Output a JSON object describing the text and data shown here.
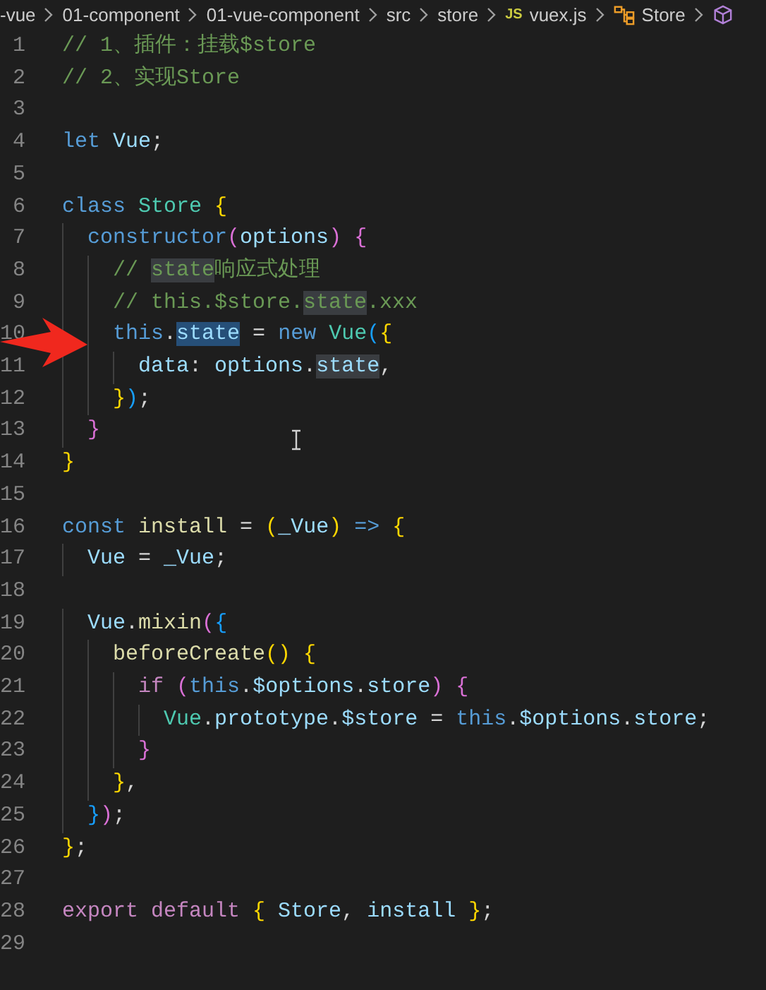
{
  "breadcrumb": [
    {
      "label": "-vue",
      "kind": "folder"
    },
    {
      "label": "01-component",
      "kind": "folder"
    },
    {
      "label": "01-vue-component",
      "kind": "folder"
    },
    {
      "label": "src",
      "kind": "folder"
    },
    {
      "label": "store",
      "kind": "folder"
    },
    {
      "label": "vuex.js",
      "kind": "js",
      "badge": "JS"
    },
    {
      "label": "Store",
      "kind": "class"
    },
    {
      "kind": "cube"
    }
  ],
  "editor": {
    "lines": [
      {
        "n": "1",
        "tokens": [
          {
            "t": "// 1、插件：挂载$store",
            "kind": "comment"
          }
        ]
      },
      {
        "n": "2",
        "tokens": [
          {
            "t": "// 2、实现Store",
            "kind": "comment"
          }
        ]
      },
      {
        "n": "3"
      },
      {
        "n": "4",
        "tokens": [
          {
            "t": "let ",
            "kind": "keyword"
          },
          {
            "t": "Vue",
            "kind": "variable"
          },
          {
            "t": ";",
            "kind": "plain"
          }
        ]
      },
      {
        "n": "5"
      },
      {
        "n": "6",
        "tokens": [
          {
            "t": "class ",
            "kind": "keyword"
          },
          {
            "t": "Store ",
            "kind": "class"
          },
          {
            "t": "{",
            "kind": "bracket1"
          }
        ]
      },
      {
        "n": "7",
        "tokens": [
          {
            "t": "  constructor",
            "kind": "keyword"
          },
          {
            "t": "(",
            "kind": "bracket2"
          },
          {
            "t": "options",
            "kind": "variable"
          },
          {
            "t": ") ",
            "kind": "bracket2"
          },
          {
            "t": "{",
            "kind": "bracket2"
          }
        ]
      },
      {
        "n": "8",
        "tokens": [
          {
            "t": "    // ",
            "kind": "comment"
          },
          {
            "t": "state",
            "kind": "comment",
            "matched": true
          },
          {
            "t": "响应式处理",
            "kind": "comment"
          }
        ]
      },
      {
        "n": "9",
        "tokens": [
          {
            "t": "    // this.$store.",
            "kind": "comment"
          },
          {
            "t": "state",
            "kind": "comment",
            "matched": true
          },
          {
            "t": ".xxx",
            "kind": "comment"
          }
        ]
      },
      {
        "n": "10",
        "tokens": [
          {
            "t": "    this",
            "kind": "keyword"
          },
          {
            "t": ".",
            "kind": "plain"
          },
          {
            "t": "state",
            "kind": "variable",
            "selected": true
          },
          {
            "t": " = ",
            "kind": "plain"
          },
          {
            "t": "new ",
            "kind": "keyword"
          },
          {
            "t": "Vue",
            "kind": "class"
          },
          {
            "t": "(",
            "kind": "bracket3"
          },
          {
            "t": "{",
            "kind": "bracket1"
          }
        ]
      },
      {
        "n": "11",
        "tokens": [
          {
            "t": "      data",
            "kind": "variable"
          },
          {
            "t": ": ",
            "kind": "plain"
          },
          {
            "t": "options",
            "kind": "variable"
          },
          {
            "t": ".",
            "kind": "plain"
          },
          {
            "t": "state",
            "kind": "variable",
            "matched": true
          },
          {
            "t": ",",
            "kind": "plain"
          }
        ]
      },
      {
        "n": "12",
        "tokens": [
          {
            "t": "    }",
            "kind": "bracket1"
          },
          {
            "t": ")",
            "kind": "bracket3"
          },
          {
            "t": ";",
            "kind": "plain"
          }
        ]
      },
      {
        "n": "13",
        "tokens": [
          {
            "t": "  }",
            "kind": "bracket2"
          }
        ]
      },
      {
        "n": "14",
        "tokens": [
          {
            "t": "}",
            "kind": "bracket1"
          }
        ]
      },
      {
        "n": "15"
      },
      {
        "n": "16",
        "tokens": [
          {
            "t": "const ",
            "kind": "keyword"
          },
          {
            "t": "install",
            "kind": "function"
          },
          {
            "t": " = ",
            "kind": "plain"
          },
          {
            "t": "(",
            "kind": "bracket1"
          },
          {
            "t": "_Vue",
            "kind": "variable"
          },
          {
            "t": ")",
            "kind": "bracket1"
          },
          {
            "t": " => ",
            "kind": "keyword"
          },
          {
            "t": "{",
            "kind": "bracket1"
          }
        ]
      },
      {
        "n": "17",
        "tokens": [
          {
            "t": "  Vue",
            "kind": "variable"
          },
          {
            "t": " = ",
            "kind": "plain"
          },
          {
            "t": "_Vue",
            "kind": "variable"
          },
          {
            "t": ";",
            "kind": "plain"
          }
        ]
      },
      {
        "n": "18"
      },
      {
        "n": "19",
        "tokens": [
          {
            "t": "  Vue",
            "kind": "variable"
          },
          {
            "t": ".",
            "kind": "plain"
          },
          {
            "t": "mixin",
            "kind": "function"
          },
          {
            "t": "(",
            "kind": "bracket2"
          },
          {
            "t": "{",
            "kind": "bracket3"
          }
        ]
      },
      {
        "n": "20",
        "tokens": [
          {
            "t": "    beforeCreate",
            "kind": "function"
          },
          {
            "t": "() ",
            "kind": "bracket1"
          },
          {
            "t": "{",
            "kind": "bracket1"
          }
        ]
      },
      {
        "n": "21",
        "tokens": [
          {
            "t": "      if ",
            "kind": "control"
          },
          {
            "t": "(",
            "kind": "bracket2"
          },
          {
            "t": "this",
            "kind": "keyword"
          },
          {
            "t": ".",
            "kind": "plain"
          },
          {
            "t": "$options",
            "kind": "variable"
          },
          {
            "t": ".",
            "kind": "plain"
          },
          {
            "t": "store",
            "kind": "variable"
          },
          {
            "t": ") ",
            "kind": "bracket2"
          },
          {
            "t": "{",
            "kind": "bracket2"
          }
        ]
      },
      {
        "n": "22",
        "tokens": [
          {
            "t": "        Vue",
            "kind": "class"
          },
          {
            "t": ".",
            "kind": "plain"
          },
          {
            "t": "prototype",
            "kind": "variable"
          },
          {
            "t": ".",
            "kind": "plain"
          },
          {
            "t": "$store",
            "kind": "variable"
          },
          {
            "t": " = ",
            "kind": "plain"
          },
          {
            "t": "this",
            "kind": "keyword"
          },
          {
            "t": ".",
            "kind": "plain"
          },
          {
            "t": "$options",
            "kind": "variable"
          },
          {
            "t": ".",
            "kind": "plain"
          },
          {
            "t": "store",
            "kind": "variable"
          },
          {
            "t": ";",
            "kind": "plain"
          }
        ]
      },
      {
        "n": "23",
        "tokens": [
          {
            "t": "      }",
            "kind": "bracket2"
          }
        ]
      },
      {
        "n": "24",
        "tokens": [
          {
            "t": "    }",
            "kind": "bracket1"
          },
          {
            "t": ",",
            "kind": "plain"
          }
        ]
      },
      {
        "n": "25",
        "tokens": [
          {
            "t": "  }",
            "kind": "bracket3"
          },
          {
            "t": ")",
            "kind": "bracket2"
          },
          {
            "t": ";",
            "kind": "plain"
          }
        ]
      },
      {
        "n": "26",
        "tokens": [
          {
            "t": "}",
            "kind": "bracket1"
          },
          {
            "t": ";",
            "kind": "plain"
          }
        ]
      },
      {
        "n": "27"
      },
      {
        "n": "28",
        "tokens": [
          {
            "t": "export ",
            "kind": "control"
          },
          {
            "t": "default ",
            "kind": "control"
          },
          {
            "t": "{ ",
            "kind": "bracket1"
          },
          {
            "t": "Store",
            "kind": "variable"
          },
          {
            "t": ", ",
            "kind": "plain"
          },
          {
            "t": "install ",
            "kind": "variable"
          },
          {
            "t": "}",
            "kind": "bracket1"
          },
          {
            "t": ";",
            "kind": "plain"
          }
        ]
      },
      {
        "n": "29"
      }
    ]
  }
}
